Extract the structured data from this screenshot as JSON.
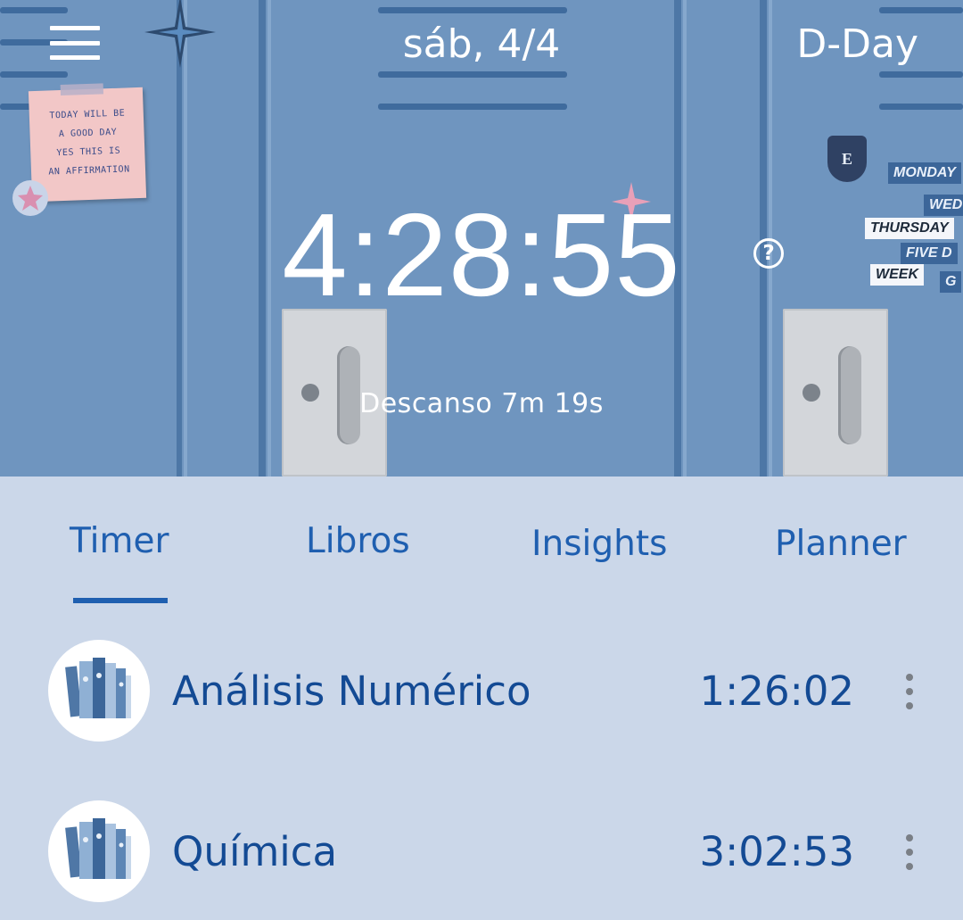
{
  "header": {
    "date": "sáb, 4/4",
    "dday_label": "D-Day",
    "menu_icon": "hamburger-menu-icon"
  },
  "timer": {
    "elapsed": "4:28:55",
    "help_icon": "question-circle-icon",
    "help_glyph": "?",
    "rest_label": "Descanso 7m 19s"
  },
  "background": {
    "note_lines": [
      "TODAY WILL BE",
      "A GOOD DAY",
      "YES THIS IS",
      "AN AFFIRMATION"
    ],
    "stickers": [
      "MONDAY",
      "WED",
      "THURSDAY",
      "FIVE D",
      "WEEK",
      "G"
    ],
    "badge_letter": "E"
  },
  "tabs": [
    {
      "label": "Timer",
      "active": true
    },
    {
      "label": "Libros",
      "active": false
    },
    {
      "label": "Insights",
      "active": false
    },
    {
      "label": "Planner",
      "active": false
    }
  ],
  "subjects": [
    {
      "name": "Análisis Numérico",
      "time": "1:26:02",
      "icon": "books-icon",
      "more_icon": "more-vertical-icon"
    },
    {
      "name": "Química",
      "time": "3:02:53",
      "icon": "books-icon",
      "more_icon": "more-vertical-icon"
    }
  ],
  "colors": {
    "accent": "#1f5fb0",
    "subject_text": "#134a94",
    "list_background": "#cbd7e9",
    "hero_background": "#6f95bf"
  }
}
